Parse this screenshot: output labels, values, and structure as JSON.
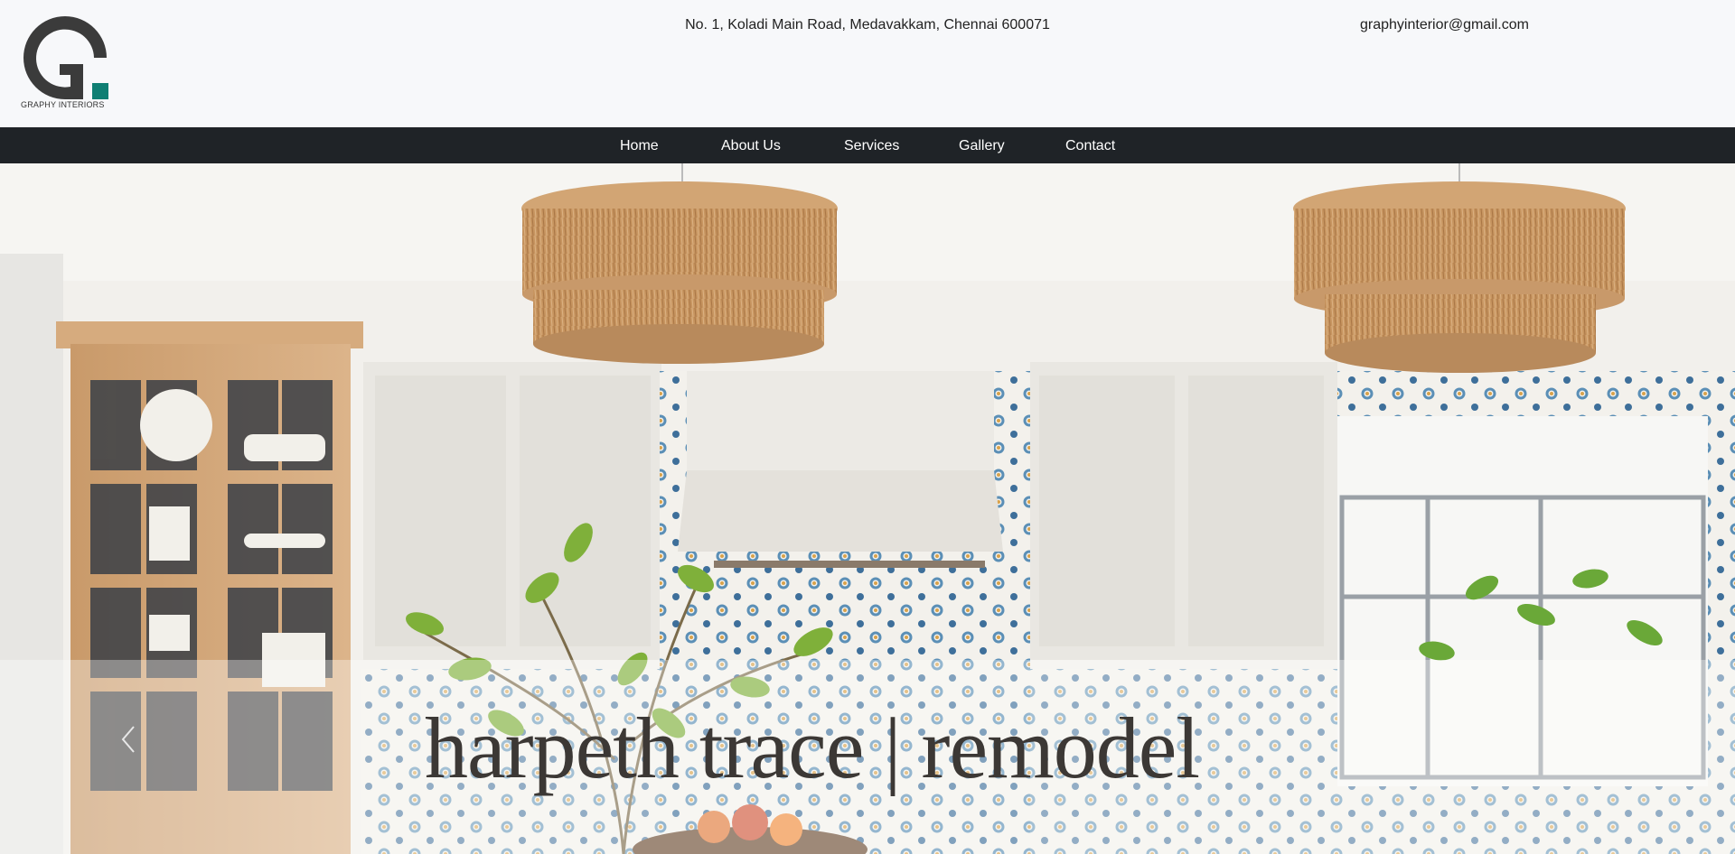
{
  "brand": {
    "logo_text": "GRAPHY INTERIORS",
    "accent_color": "#0f7f73",
    "logo_color": "#3b3b3b"
  },
  "header": {
    "address": "No. 1, Koladi Main Road, Medavakkam, Chennai 600071",
    "email": "graphyinterior@gmail.com"
  },
  "nav": {
    "items": [
      {
        "label": "Home"
      },
      {
        "label": "About Us"
      },
      {
        "label": "Services"
      },
      {
        "label": "Gallery"
      },
      {
        "label": "Contact"
      }
    ]
  },
  "hero": {
    "title": "harpeth trace |  remodel",
    "prev_icon": "chevron-left-icon"
  }
}
